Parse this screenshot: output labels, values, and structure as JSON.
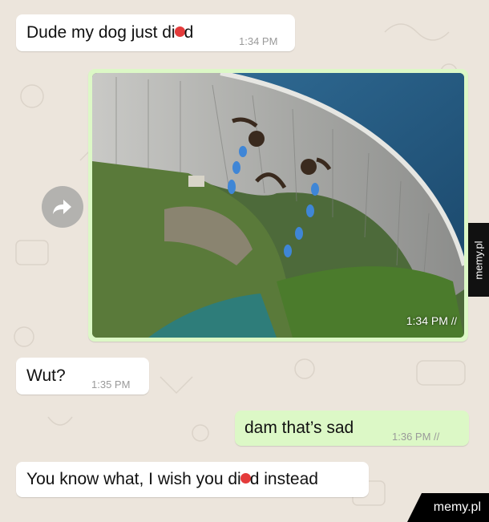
{
  "messages": [
    {
      "id": "m1",
      "direction": "incoming",
      "text_before": "Dude my dog just di",
      "text_after": "d",
      "time": "1:34 PM"
    },
    {
      "id": "m2",
      "direction": "outgoing",
      "type": "image",
      "time": "1:34 PM",
      "ticks": "//"
    },
    {
      "id": "m3",
      "direction": "incoming",
      "text": "Wut?",
      "time": "1:35 PM"
    },
    {
      "id": "m4",
      "direction": "outgoing",
      "text": "dam that’s sad",
      "time": "1:36 PM",
      "ticks": "//"
    },
    {
      "id": "m5",
      "direction": "incoming",
      "text_before": "You know what, I wish you di",
      "text_after": "d instead"
    }
  ],
  "icons": {
    "forward": "forward-arrow-icon",
    "read_receipt": "double-check-icon",
    "censor_emoji": "censor-emoji-icon"
  },
  "watermarks": {
    "side": "memy.pl",
    "corner": "memy.pl"
  },
  "colors": {
    "background": "#ece5dc",
    "incoming_bubble": "#ffffff",
    "outgoing_bubble": "#dcf8c6",
    "timestamp": "#9a9a9a"
  }
}
